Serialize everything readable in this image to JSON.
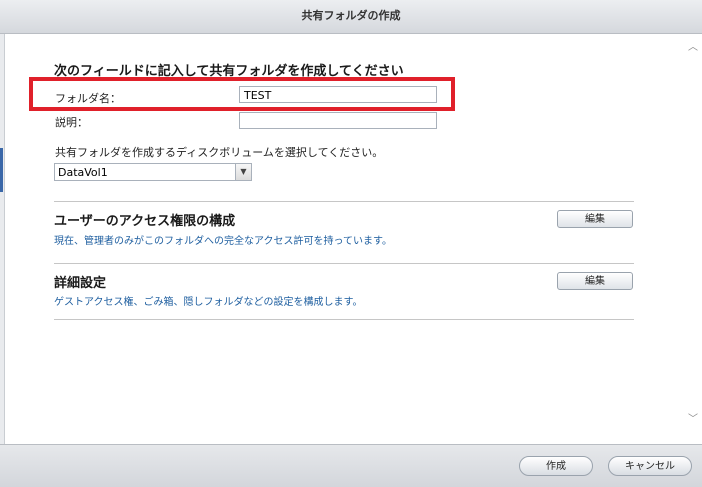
{
  "window": {
    "title": "共有フォルダの作成"
  },
  "form": {
    "heading": "次のフィールドに記入して共有フォルダを作成してください",
    "folder_name_label": "フォルダ名：",
    "folder_name_value": "TEST",
    "description_label": "説明：",
    "description_value": "",
    "volume_instruction": "共有フォルダを作成するディスクボリュームを選択してください。",
    "volume_selected": "DataVol1"
  },
  "sections": {
    "access": {
      "title": "ユーザーのアクセス権限の構成",
      "desc": "現在、管理者のみがこのフォルダへの完全なアクセス許可を持っています。",
      "edit_label": "編集"
    },
    "advanced": {
      "title": "詳細設定",
      "desc": "ゲストアクセス権、ごみ箱、隠しフォルダなどの設定を構成します。",
      "edit_label": "編集"
    }
  },
  "footer": {
    "create_label": "作成",
    "cancel_label": "キャンセル"
  },
  "icons": {
    "scroll_up": "chevron-up-icon",
    "scroll_down": "chevron-down-icon",
    "dropdown": "triangle-down-icon"
  },
  "colors": {
    "highlight": "#e0202a",
    "link_text": "#1f5fa0"
  }
}
